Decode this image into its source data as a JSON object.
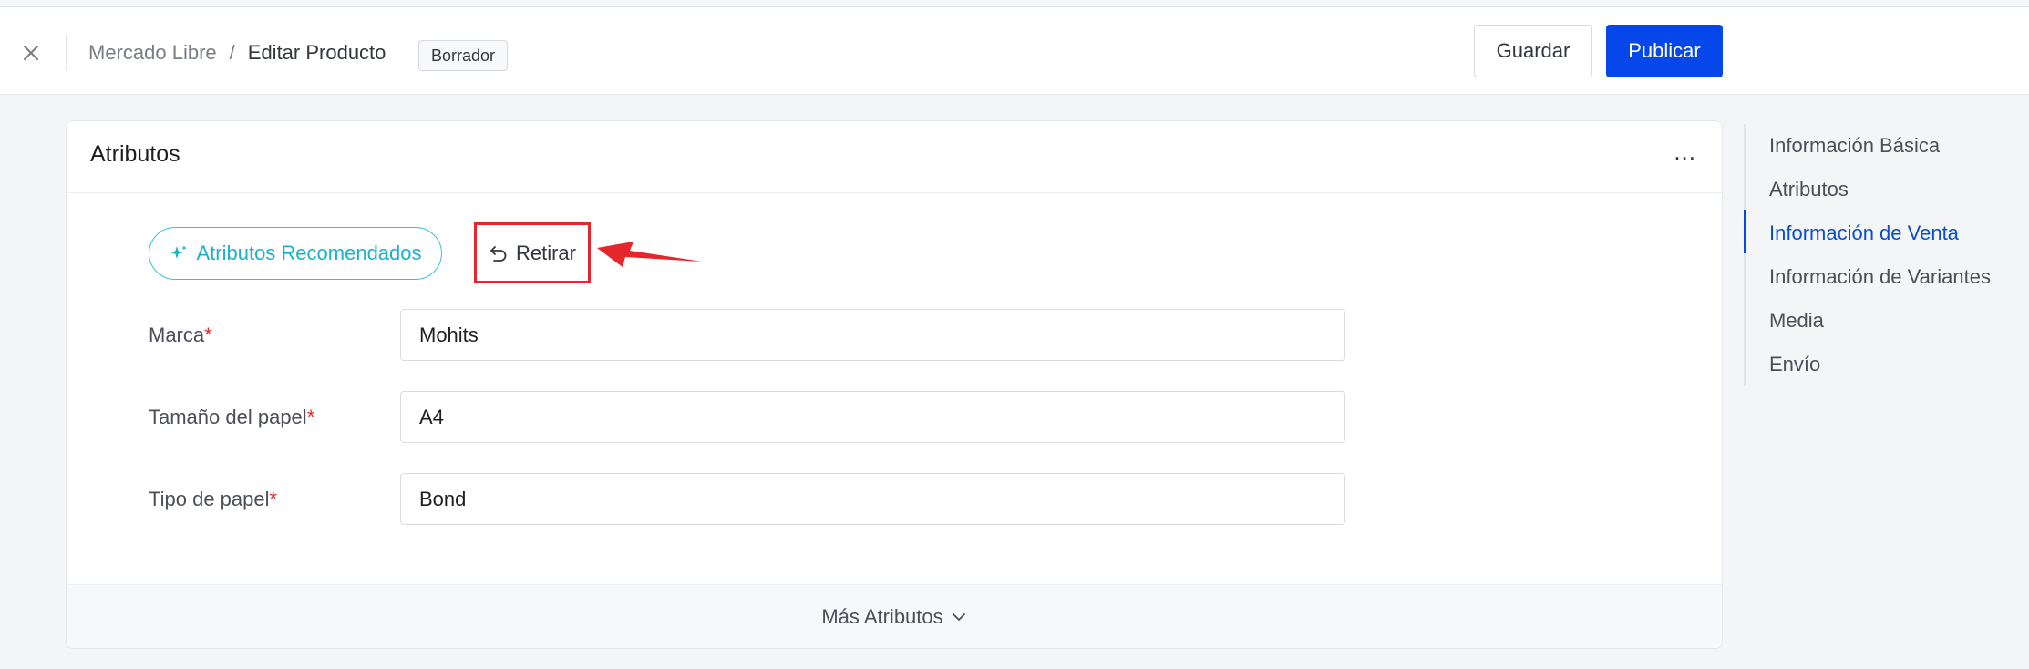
{
  "header": {
    "breadcrumb": {
      "parent": "Mercado Libre",
      "separator": "/",
      "current": "Editar Producto"
    },
    "status_badge": "Borrador",
    "save_label": "Guardar",
    "publish_label": "Publicar",
    "icons": {
      "close": "close-icon"
    }
  },
  "card": {
    "title": "Atributos",
    "more_menu": "...",
    "recommend_button": "Atributos Recomendados",
    "withdraw_button": "Retirar",
    "fields": [
      {
        "label": "Marca",
        "required": "*",
        "value": "Mohits"
      },
      {
        "label": "Tamaño del papel",
        "required": "*",
        "value": "A4"
      },
      {
        "label": "Tipo de papel",
        "required": "*",
        "value": "Bond"
      }
    ],
    "more_attributes": "Más Atributos"
  },
  "toc": {
    "items": [
      {
        "label": "Información Básica",
        "active": false
      },
      {
        "label": "Atributos",
        "active": false
      },
      {
        "label": "Información de Venta",
        "active": true
      },
      {
        "label": "Información de Variantes",
        "active": false
      },
      {
        "label": "Media",
        "active": false
      },
      {
        "label": "Envío",
        "active": false
      }
    ]
  },
  "colors": {
    "primary": "#0647e9",
    "accent_teal": "#17b3c8",
    "required": "#e5262c",
    "annotation_red": "#e5262c"
  }
}
